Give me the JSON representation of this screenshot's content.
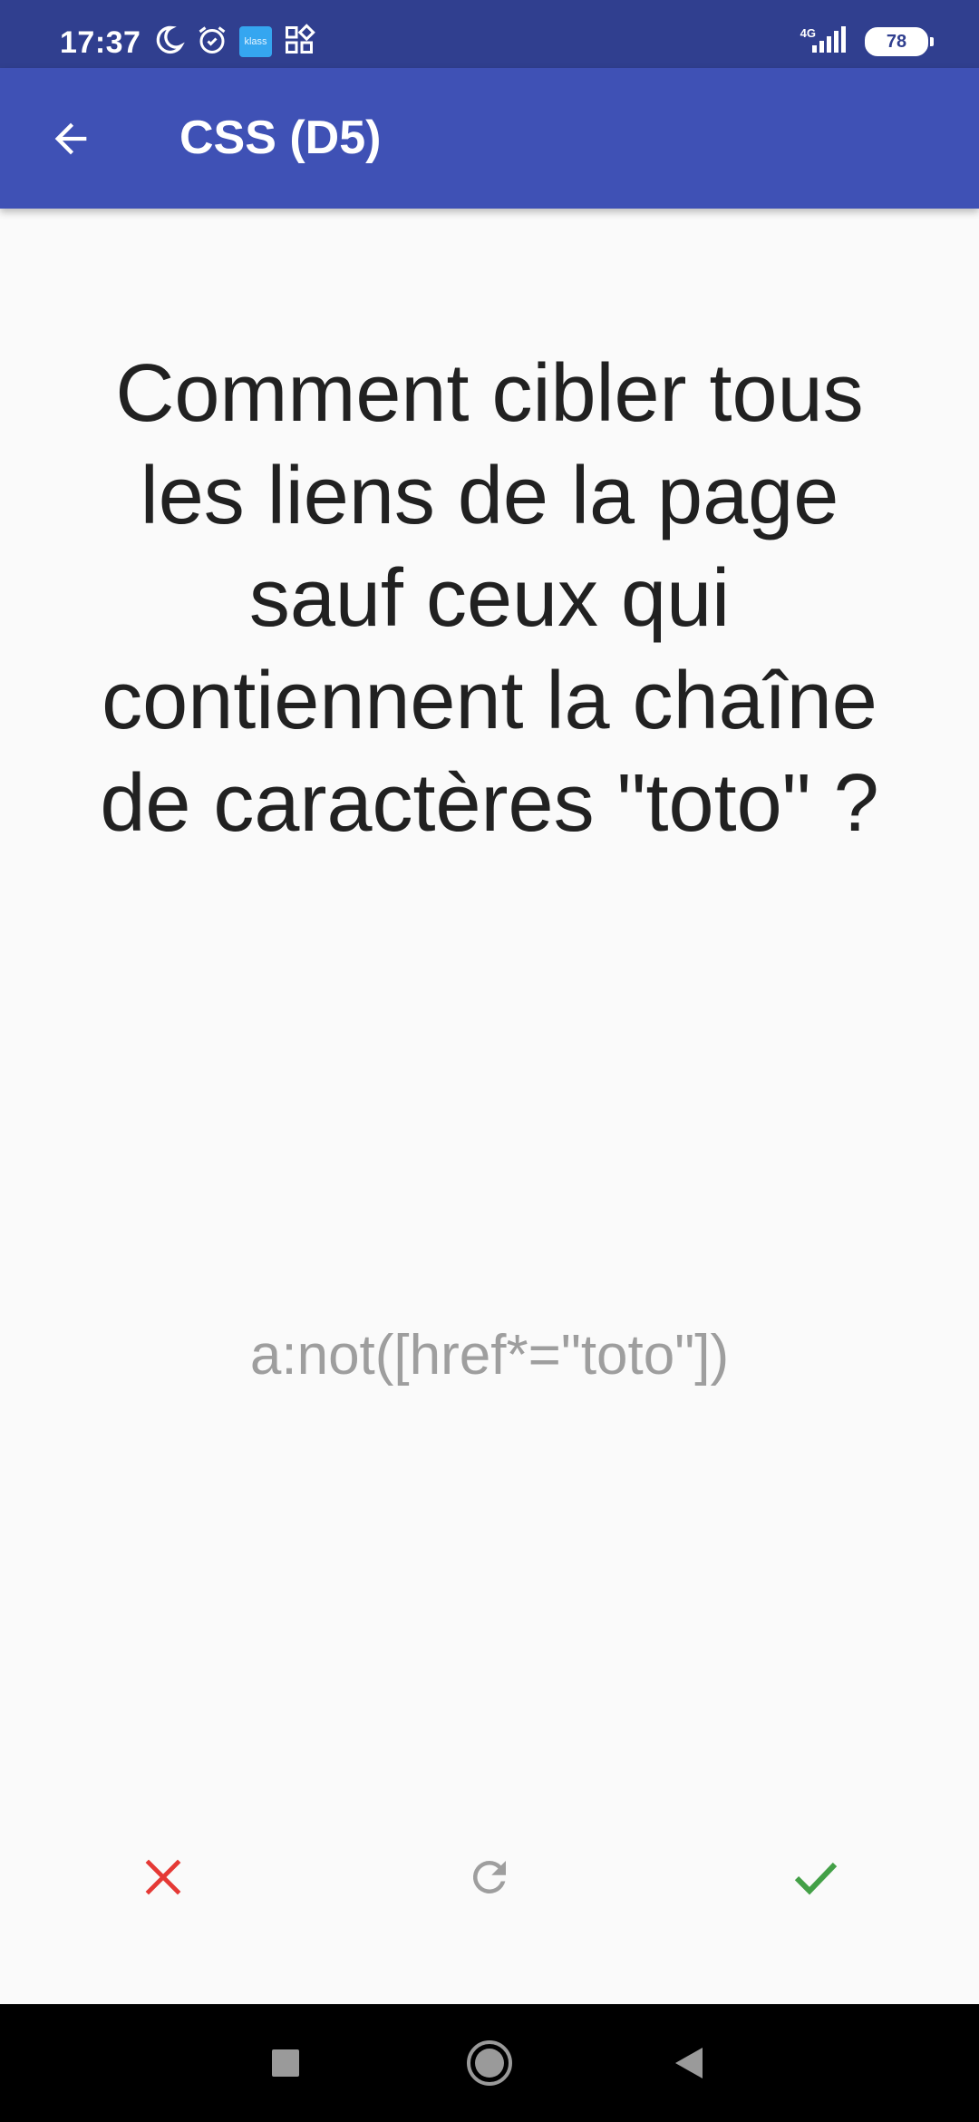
{
  "status_bar": {
    "time": "17:37",
    "klass_label": "klass",
    "network": "4G",
    "battery": "78"
  },
  "app_bar": {
    "title": "CSS (D5)"
  },
  "card": {
    "question": "Comment cibler tous les liens de la page sauf ceux qui contiennent la chaîne de caractères \"toto\" ?",
    "answer": "a:not([href*=\"toto\"])"
  },
  "colors": {
    "status_bar": "#303f8f",
    "app_bar": "#3f51b5",
    "wrong": "#e53935",
    "reset": "#9e9e9e",
    "right": "#43a047"
  },
  "icons": {
    "back": "arrow-left",
    "wrong": "close",
    "reset": "refresh",
    "right": "check"
  }
}
